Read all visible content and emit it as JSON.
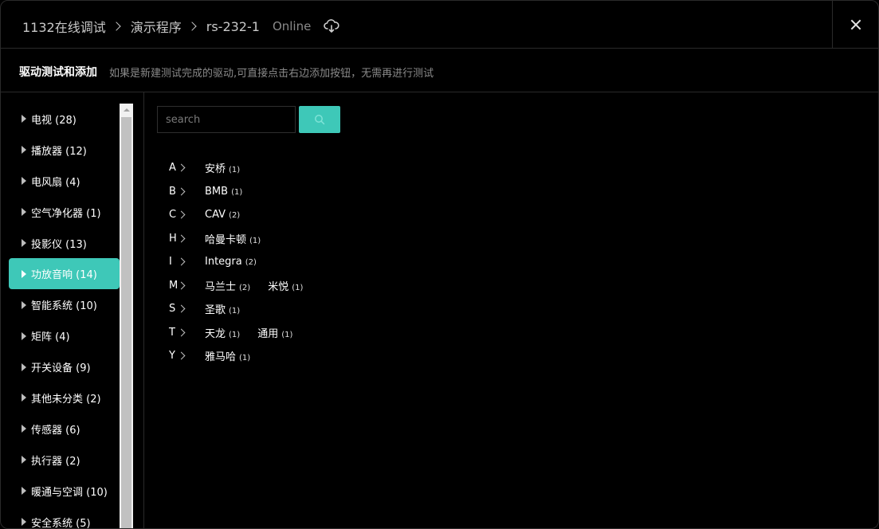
{
  "header": {
    "breadcrumbs": [
      "1132在线调试",
      "演示程序",
      "rs-232-1"
    ],
    "status": "Online"
  },
  "subheader": {
    "title": "驱动测试和添加",
    "description": "如果是新建测试完成的驱动,可直接点击右边添加按钮，无需再进行测试"
  },
  "sidebar": {
    "items": [
      {
        "label": "电视 (28)",
        "active": false
      },
      {
        "label": "播放器 (12)",
        "active": false
      },
      {
        "label": "电风扇 (4)",
        "active": false
      },
      {
        "label": "空气净化器 (1)",
        "active": false
      },
      {
        "label": "投影仪 (13)",
        "active": false
      },
      {
        "label": "功放音响 (14)",
        "active": true
      },
      {
        "label": "智能系统 (10)",
        "active": false
      },
      {
        "label": "矩阵 (4)",
        "active": false
      },
      {
        "label": "开关设备 (9)",
        "active": false
      },
      {
        "label": "其他未分类 (2)",
        "active": false
      },
      {
        "label": "传感器 (6)",
        "active": false
      },
      {
        "label": "执行器 (2)",
        "active": false
      },
      {
        "label": "暖通与空调 (10)",
        "active": false
      },
      {
        "label": "安全系统 (5)",
        "active": false
      }
    ]
  },
  "search": {
    "placeholder": "search",
    "value": ""
  },
  "brand_groups": [
    {
      "letter": "A",
      "brands": [
        {
          "name": "安桥",
          "count": "(1)"
        }
      ]
    },
    {
      "letter": "B",
      "brands": [
        {
          "name": "BMB",
          "count": "(1)"
        }
      ]
    },
    {
      "letter": "C",
      "brands": [
        {
          "name": "CAV",
          "count": "(2)"
        }
      ]
    },
    {
      "letter": "H",
      "brands": [
        {
          "name": "哈曼卡顿",
          "count": "(1)"
        }
      ]
    },
    {
      "letter": "I",
      "brands": [
        {
          "name": "Integra",
          "count": "(2)"
        }
      ]
    },
    {
      "letter": "M",
      "brands": [
        {
          "name": "马兰士",
          "count": "(2)"
        },
        {
          "name": "米悦",
          "count": "(1)"
        }
      ]
    },
    {
      "letter": "S",
      "brands": [
        {
          "name": "圣歌",
          "count": "(1)"
        }
      ]
    },
    {
      "letter": "T",
      "brands": [
        {
          "name": "天龙",
          "count": "(1)"
        },
        {
          "name": "通用",
          "count": "(1)"
        }
      ]
    },
    {
      "letter": "Y",
      "brands": [
        {
          "name": "雅马哈",
          "count": "(1)"
        }
      ]
    }
  ],
  "colors": {
    "accent": "#3ec8b8",
    "background": "#000000",
    "divider": "#2a2a2a",
    "muted_text": "#8a8a8a"
  },
  "icons": {
    "cloud": "cloud-sync-icon",
    "close": "close-icon",
    "search": "search-icon"
  }
}
